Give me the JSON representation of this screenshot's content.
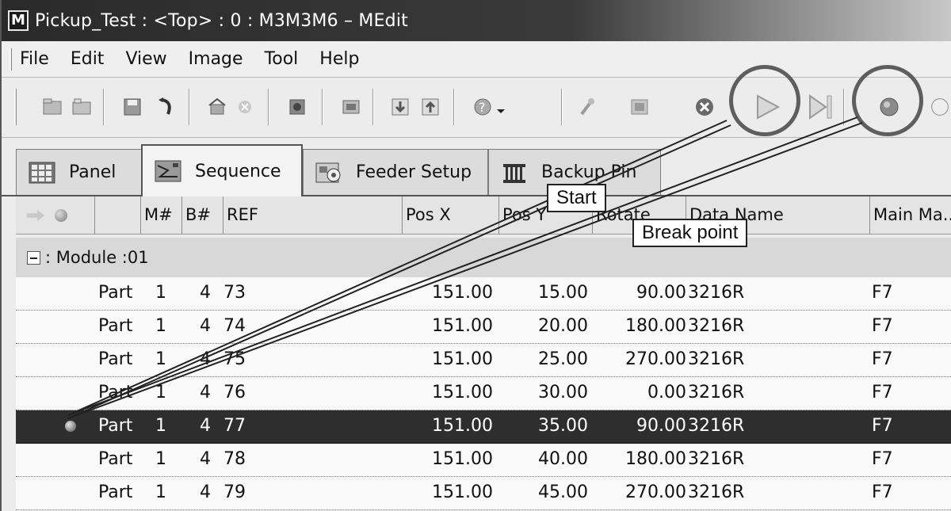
{
  "window": {
    "title": "Pickup_Test : <Top> : 0 : M3M3M6 – MEdit",
    "app_icon_letter": "M"
  },
  "menu": [
    "File",
    "Edit",
    "View",
    "Image",
    "Tool",
    "Help"
  ],
  "toolbar": {
    "icons": [
      "open-icon",
      "folder-icon",
      "save-icon",
      "undo-icon",
      "home-icon",
      "close-small-icon",
      "import-icon",
      "export-icon",
      "download-icon",
      "upload-icon",
      "help-icon",
      "pin-icon",
      "image-icon",
      "stop-icon",
      "play-icon",
      "step-icon",
      "breakpoint-icon"
    ]
  },
  "tabs": [
    {
      "label": "Panel",
      "icon": "panel-grid-icon"
    },
    {
      "label": "Sequence",
      "icon": "sequence-icon"
    },
    {
      "label": "Feeder Setup",
      "icon": "feeder-icon"
    },
    {
      "label": "Backup Pin",
      "icon": "pin-rack-icon"
    }
  ],
  "columns": [
    "M#",
    "B#",
    "REF",
    "Pos X",
    "Pos Y",
    "Rotate",
    "Data Name",
    "Main Ma..."
  ],
  "group": {
    "label": ": Module :01"
  },
  "rows": [
    {
      "type": "Part",
      "m": "1",
      "b": "4",
      "ref": "73",
      "x": "151.00",
      "y": "15.00",
      "rot": "90.00",
      "data": "3216R",
      "main": "F7",
      "selected": false
    },
    {
      "type": "Part",
      "m": "1",
      "b": "4",
      "ref": "74",
      "x": "151.00",
      "y": "20.00",
      "rot": "180.00",
      "data": "3216R",
      "main": "F7",
      "selected": false
    },
    {
      "type": "Part",
      "m": "1",
      "b": "4",
      "ref": "75",
      "x": "151.00",
      "y": "25.00",
      "rot": "270.00",
      "data": "3216R",
      "main": "F7",
      "selected": false
    },
    {
      "type": "Part",
      "m": "1",
      "b": "4",
      "ref": "76",
      "x": "151.00",
      "y": "30.00",
      "rot": "0.00",
      "data": "3216R",
      "main": "F7",
      "selected": false
    },
    {
      "type": "Part",
      "m": "1",
      "b": "4",
      "ref": "77",
      "x": "151.00",
      "y": "35.00",
      "rot": "90.00",
      "data": "3216R",
      "main": "F7",
      "selected": true
    },
    {
      "type": "Part",
      "m": "1",
      "b": "4",
      "ref": "78",
      "x": "151.00",
      "y": "40.00",
      "rot": "180.00",
      "data": "3216R",
      "main": "F7",
      "selected": false
    },
    {
      "type": "Part",
      "m": "1",
      "b": "4",
      "ref": "79",
      "x": "151.00",
      "y": "45.00",
      "rot": "270.00",
      "data": "3216R",
      "main": "F7",
      "selected": false
    }
  ],
  "callouts": {
    "start": "Start",
    "breakpoint": "Break point"
  }
}
